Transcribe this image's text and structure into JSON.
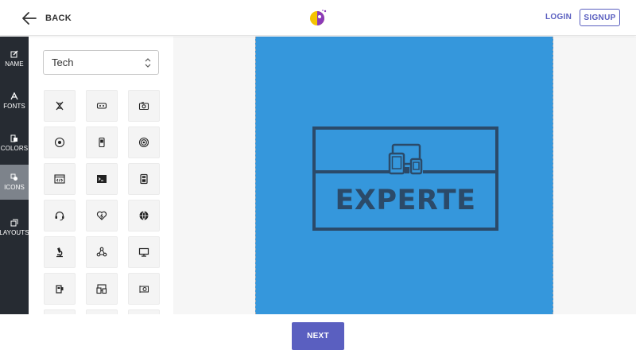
{
  "header": {
    "back_label": "BACK",
    "login_label": "LOGIN",
    "signup_label": "SIGNUP",
    "accent_color": "#5a5fc0"
  },
  "sidebar": {
    "items": [
      {
        "label": "NAME",
        "icon": "edit-icon"
      },
      {
        "label": "FONTS",
        "icon": "font-icon"
      },
      {
        "label": "COLORS",
        "icon": "palette-icon"
      },
      {
        "label": "ICONS",
        "icon": "shapes-icon",
        "active": true
      },
      {
        "label": "LAYOUTS",
        "icon": "layout-icon"
      }
    ]
  },
  "panel": {
    "category_value": "Tech",
    "icons": [
      "dna-icon",
      "vr-headset-icon",
      "camera-icon",
      "cd-disc-icon",
      "mobile-phone-icon",
      "wireless-signal-icon",
      "code-window-icon",
      "terminal-icon",
      "calculator-icon",
      "headset-icon",
      "heart-bolt-icon",
      "globe-icon",
      "microscope-icon",
      "network-nodes-icon",
      "monitor-icon",
      "usb-device-icon",
      "devices-icon",
      "graphics-card-icon"
    ]
  },
  "canvas": {
    "background_color": "#3597dc",
    "logo_text": "EXPERTE",
    "logo_color": "#2b4a69",
    "logo_icon": "devices-icon"
  },
  "footer": {
    "next_label": "NEXT"
  }
}
